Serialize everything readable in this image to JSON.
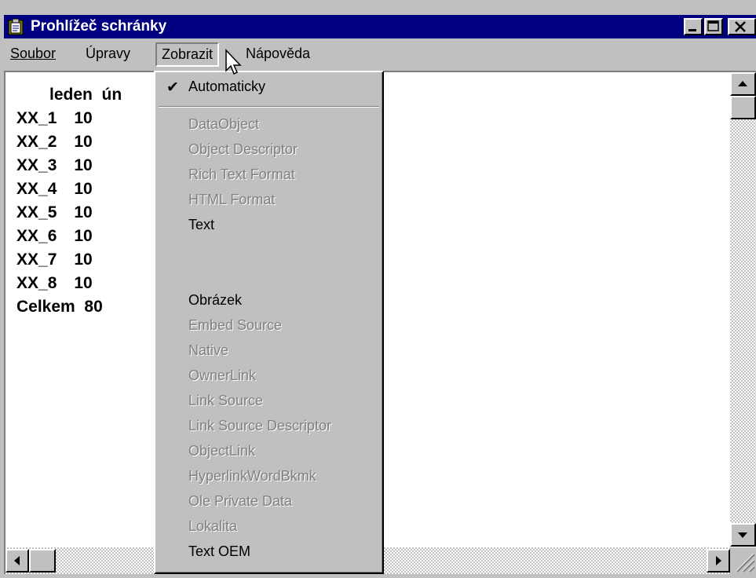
{
  "window": {
    "title": "Prohlížeč schránky",
    "controls": [
      "minimize",
      "maximize",
      "close"
    ]
  },
  "menubar": {
    "items": [
      {
        "label": "Soubor",
        "underline": "S"
      },
      {
        "label": "Úpravy",
        "underline": "r"
      },
      {
        "label": "Zobrazit",
        "underline": "Z",
        "open": true
      },
      {
        "label": "Nápověda",
        "underline": "v"
      }
    ]
  },
  "content": {
    "header": "leden  ún",
    "rows": [
      {
        "name": "XX_1",
        "value": "10"
      },
      {
        "name": "XX_2",
        "value": "10"
      },
      {
        "name": "XX_3",
        "value": "10"
      },
      {
        "name": "XX_4",
        "value": "10"
      },
      {
        "name": "XX_5",
        "value": "10"
      },
      {
        "name": "XX_6",
        "value": "10"
      },
      {
        "name": "XX_7",
        "value": "10"
      },
      {
        "name": "XX_8",
        "value": "10"
      }
    ],
    "total": {
      "name": "Celkem",
      "value": "80"
    }
  },
  "dropdown": {
    "checked_item": "Automaticky",
    "items": [
      {
        "label": "Automaticky",
        "enabled": true,
        "checked": true
      },
      {
        "label": "DataObject",
        "enabled": false
      },
      {
        "label": "Object Descriptor",
        "enabled": false
      },
      {
        "label": "Rich Text Format",
        "enabled": false
      },
      {
        "label": "HTML Format",
        "enabled": false
      },
      {
        "label": "Text",
        "enabled": true
      },
      {
        "label": "Obrázek",
        "enabled": true
      },
      {
        "label": "Embed Source",
        "enabled": false
      },
      {
        "label": "Native",
        "enabled": false
      },
      {
        "label": "OwnerLink",
        "enabled": false
      },
      {
        "label": "Link Source",
        "enabled": false
      },
      {
        "label": "Link Source Descriptor",
        "enabled": false
      },
      {
        "label": "ObjectLink",
        "enabled": false
      },
      {
        "label": "HyperlinkWordBkmk",
        "enabled": false
      },
      {
        "label": "Ole Private Data",
        "enabled": false
      },
      {
        "label": "Lokalita",
        "enabled": false
      },
      {
        "label": "Text OEM",
        "enabled": true
      }
    ]
  },
  "colors": {
    "titlebar": "#000080",
    "face": "#c0c0c0",
    "disabled_text": "#808080"
  }
}
